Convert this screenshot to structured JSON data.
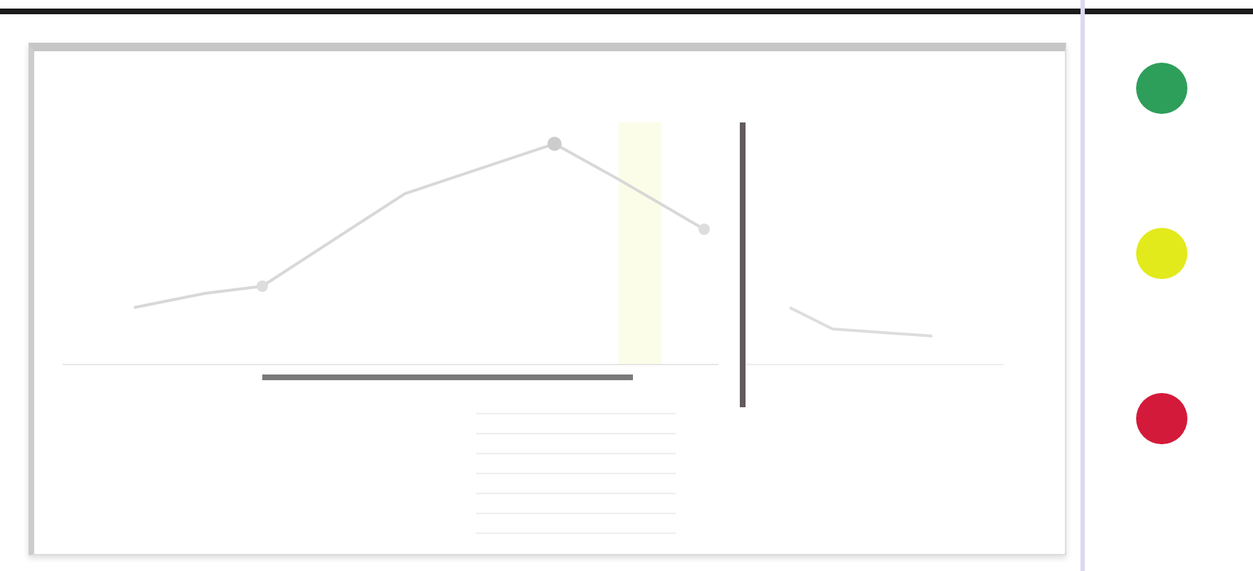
{
  "status_lights": [
    {
      "color": "#2e9e5b"
    },
    {
      "color": "#e2ea1c"
    },
    {
      "color": "#d41a3a"
    }
  ]
}
